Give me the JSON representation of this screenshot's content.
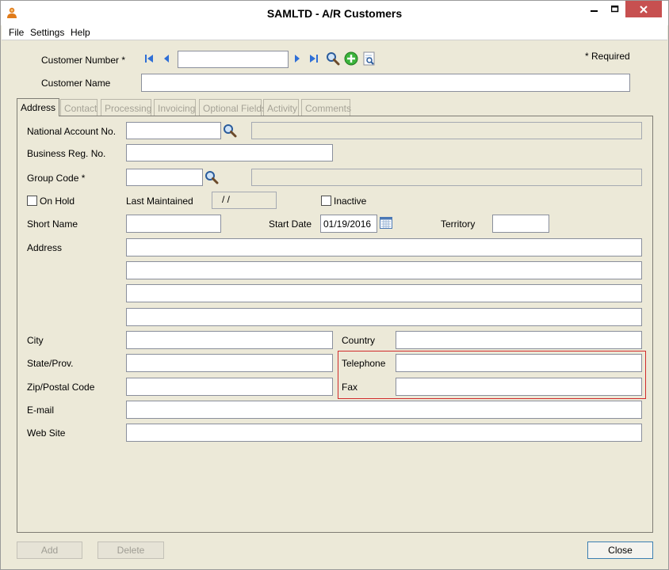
{
  "window": {
    "title": "SAMLTD - A/R Customers"
  },
  "menu": {
    "items": [
      "File",
      "Settings",
      "Help"
    ]
  },
  "header": {
    "customer_number_label": "Customer Number *",
    "customer_number_value": "",
    "required_note": "* Required",
    "customer_name_label": "Customer Name",
    "customer_name_value": ""
  },
  "tabs": [
    {
      "label": "Address",
      "active": true
    },
    {
      "label": "Contact",
      "active": false
    },
    {
      "label": "Processing",
      "active": false
    },
    {
      "label": "Invoicing",
      "active": false
    },
    {
      "label": "Optional Fields",
      "active": false
    },
    {
      "label": "Activity",
      "active": false
    },
    {
      "label": "Comments",
      "active": false
    }
  ],
  "form": {
    "national_account_label": "National Account No.",
    "business_reg_label": "Business Reg. No.",
    "group_code_label": "Group Code *",
    "on_hold_label": "On Hold",
    "last_maintained_label": "Last Maintained",
    "last_maintained_value": "/ /",
    "inactive_label": "Inactive",
    "short_name_label": "Short Name",
    "start_date_label": "Start Date",
    "start_date_value": "01/19/2016",
    "territory_label": "Territory",
    "address_label": "Address",
    "city_label": "City",
    "country_label": "Country",
    "state_label": "State/Prov.",
    "telephone_label": "Telephone",
    "zip_label": "Zip/Postal Code",
    "fax_label": "Fax",
    "email_label": "E-mail",
    "website_label": "Web Site"
  },
  "buttons": {
    "add": "Add",
    "delete": "Delete",
    "close": "Close"
  },
  "colors": {
    "background": "#ece9d8",
    "highlight": "#d12b2b",
    "nav_blue": "#2f6fd6"
  }
}
